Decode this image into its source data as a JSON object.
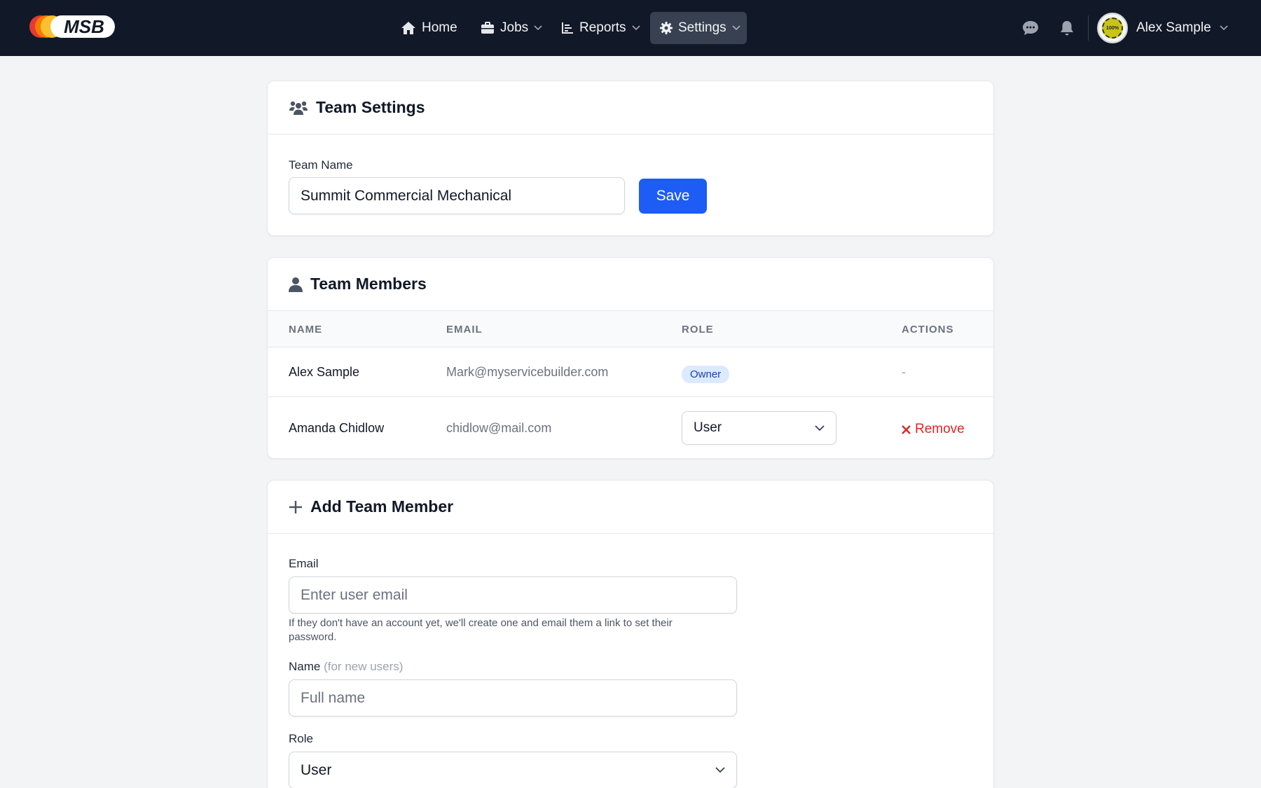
{
  "app": {
    "logo_text": "MSB"
  },
  "nav": {
    "items": [
      {
        "label": "Home",
        "icon": "home-icon"
      },
      {
        "label": "Jobs",
        "icon": "briefcase-icon"
      },
      {
        "label": "Reports",
        "icon": "chart-bar-icon"
      },
      {
        "label": "Settings",
        "icon": "gear-icon",
        "active": true
      }
    ],
    "user": {
      "name": "Alex Sample",
      "avatar_text": "100%"
    }
  },
  "team_settings": {
    "title": "Team Settings",
    "team_name_label": "Team Name",
    "team_name_value": "Summit Commercial Mechanical",
    "save_label": "Save"
  },
  "team_members": {
    "title": "Team Members",
    "columns": [
      "NAME",
      "EMAIL",
      "ROLE",
      "ACTIONS"
    ],
    "rows": [
      {
        "name": "Alex Sample",
        "email": "Mark@myservicebuilder.com",
        "role": "Owner",
        "action": "-"
      },
      {
        "name": "Amanda Chidlow",
        "email": "chidlow@mail.com",
        "role": "User",
        "action": "Remove"
      }
    ]
  },
  "add_member": {
    "title": "Add Team Member",
    "email_label": "Email",
    "email_placeholder": "Enter user email",
    "email_help": "If they don't have an account yet, we'll create one and email them a link to set their password.",
    "name_label": "Name",
    "name_hint": "(for new users)",
    "name_placeholder": "Full name",
    "role_label": "Role",
    "role_value": "User"
  },
  "colors": {
    "nav_bg": "#111827",
    "primary": "#1d5cf5",
    "danger": "#dc2626",
    "badge_bg": "#dbeafe",
    "badge_text": "#1e40af"
  }
}
